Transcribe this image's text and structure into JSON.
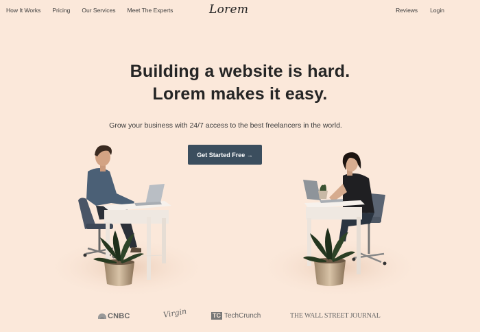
{
  "nav": {
    "left": [
      "How It Works",
      "Pricing",
      "Our Services",
      "Meet The Experts"
    ],
    "right": [
      "Reviews",
      "Login"
    ],
    "logo": "Lorem"
  },
  "hero": {
    "headline_line1": "Building a website is hard.",
    "headline_line2": "Lorem makes it easy.",
    "subtitle": "Grow your business with 24/7 access to the best freelancers in the world.",
    "cta_label": "Get Started Free →"
  },
  "press": {
    "cnbc": "CNBC",
    "virgin": "Virgin",
    "techcrunch": "TechCrunch",
    "wsj": "THE WALL STREET JOURNAL"
  },
  "colors": {
    "background": "#fbe8da",
    "cta": "#3b4e5e"
  }
}
